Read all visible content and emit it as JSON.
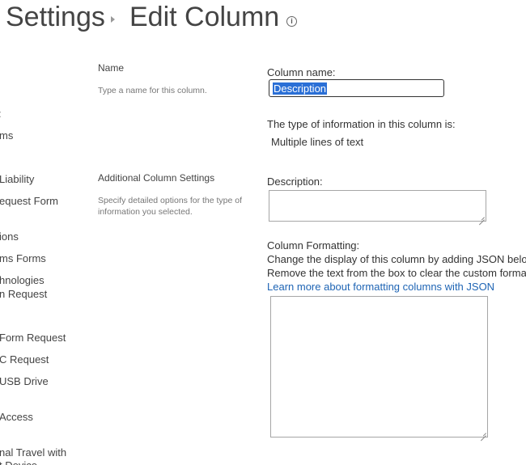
{
  "header": {
    "crumb_parent": "Settings",
    "crumb_current": "Edit Column",
    "info_glyph": "i"
  },
  "nav": {
    "items": [
      ":",
      "ms",
      "Liability",
      "equest Form",
      "ions",
      "ms Forms",
      "hnologies",
      "n Request",
      "Form Request",
      "C Request",
      "USB Drive",
      "Access",
      "nal Travel with",
      "t Device"
    ]
  },
  "sections": {
    "name": {
      "title": "Name",
      "description": "Type a name for this column."
    },
    "additional": {
      "title": "Additional Column Settings",
      "description": "Specify detailed options for the type of information you selected."
    }
  },
  "form": {
    "column_name_label": "Column name:",
    "column_name_value": "Description",
    "type_label": "The type of information in this column is:",
    "type_value": "Multiple lines of text",
    "description_label": "Description:",
    "description_value": "",
    "formatting_label": "Column Formatting:",
    "formatting_help_1": "Change the display of this column by adding JSON belo",
    "formatting_help_2": "Remove the text from the box to clear the custom forma",
    "formatting_link": "Learn more about formatting columns with JSON",
    "formatting_value": ""
  },
  "colors": {
    "selection": "#2a6fd6",
    "link": "#1e64b4"
  }
}
